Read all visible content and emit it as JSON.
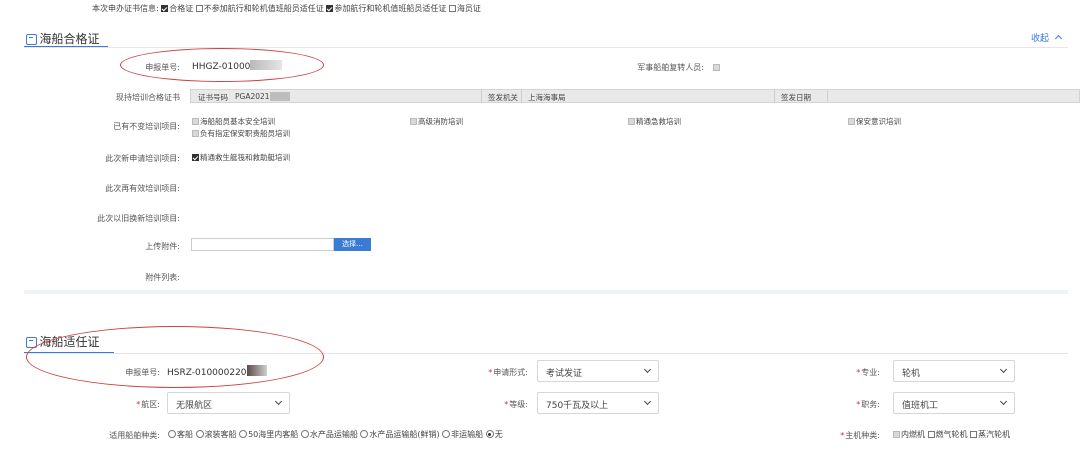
{
  "topline": {
    "label": "本次申办证书信息:",
    "options": [
      {
        "label": "合格证",
        "checked": true
      },
      {
        "label": "不参加航行和轮机值班船员适任证",
        "checked": false
      },
      {
        "label": "参加航行和轮机值班船员适任证",
        "checked": true
      },
      {
        "label": "海员证",
        "checked": false
      }
    ]
  },
  "section1": {
    "title": "海船合格证",
    "collapse_label": "收起",
    "apply_no_label": "申报单号:",
    "apply_no_value": "HHGZ-01000",
    "military_label": "军事船舶复转人员:",
    "current_cert_label": "现持培训合格证书",
    "cert_bar": {
      "no_label": "证书号码",
      "no_value": "PGA2021",
      "issuer_label": "签发机关",
      "issuer_value": "上海海事局",
      "date_label": "签发日期"
    },
    "no_change_label": "已有不变培训项目:",
    "no_change_items": [
      "海船船员基本安全培训",
      "高级消防培训",
      "精通急救培训",
      "保安意识培训",
      "负有指定保安职责船员培训"
    ],
    "new_label": "此次新申请培训项目:",
    "new_item": "精通救生艇筏和救助艇培训",
    "revalid_label": "此次再有效培训项目:",
    "renew_label": "此次以旧换新培训项目:",
    "upload_label": "上传附件:",
    "upload_button": "选择...",
    "attach_label": "附件列表:"
  },
  "section2": {
    "title": "海船适任证",
    "apply_no_label": "申报单号:",
    "apply_no_value": "HSRZ-010000220",
    "form_label": "申请形式:",
    "form_value": "考试发证",
    "major_label": "专业:",
    "major_value": "轮机",
    "area_label": "航区:",
    "area_value": "无限航区",
    "grade_label": "等级:",
    "grade_value": "750千瓦及以上",
    "duty_label": "职务:",
    "duty_value": "值班机工",
    "ship_type_label": "适用船舶种类:",
    "ship_types": [
      {
        "label": "客船",
        "selected": false
      },
      {
        "label": "滚装客船",
        "selected": false
      },
      {
        "label": "50海里内客船",
        "selected": false
      },
      {
        "label": "水产品运输船",
        "selected": false
      },
      {
        "label": "水产品运输船(鲜销)",
        "selected": false
      },
      {
        "label": "非运输船",
        "selected": false
      },
      {
        "label": "无",
        "selected": true
      }
    ],
    "engine_label": "主机种类:",
    "engines": [
      {
        "label": "内燃机",
        "checked": false
      },
      {
        "label": "燃气轮机",
        "checked": false
      },
      {
        "label": "蒸汽轮机",
        "checked": false
      }
    ]
  },
  "colors": {
    "accent": "#3a7bd5",
    "annotation": "#d04040",
    "required": "#e23"
  }
}
